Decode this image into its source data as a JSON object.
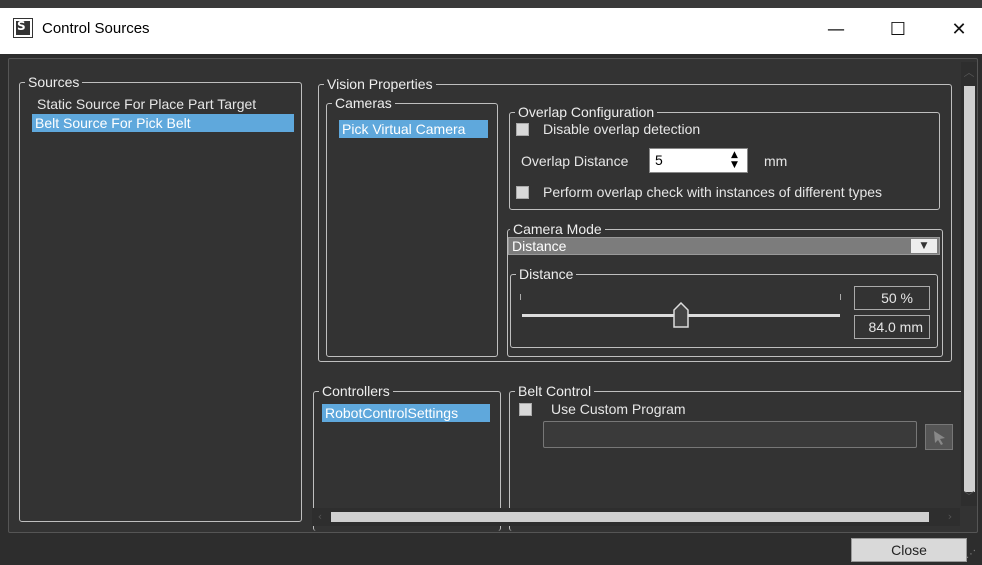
{
  "window": {
    "title": "Control Sources",
    "minimize_glyph": "—",
    "maximize_glyph": "☐",
    "close_glyph": "✕"
  },
  "sources": {
    "legend": "Sources",
    "items": [
      {
        "label": "Static Source For Place Part Target",
        "selected": false
      },
      {
        "label": "Belt Source For Pick Belt",
        "selected": true
      }
    ]
  },
  "vision": {
    "legend": "Vision Properties",
    "cameras": {
      "legend": "Cameras",
      "items": [
        "Pick Virtual Camera"
      ]
    },
    "overlap": {
      "legend": "Overlap Configuration",
      "disable_label": "Disable overlap detection",
      "distance_label": "Overlap Distance",
      "distance_value": "5",
      "distance_unit": "mm",
      "different_types_label": "Perform overlap check with instances of different types"
    },
    "camera_mode": {
      "legend": "Camera Mode",
      "selected": "Distance"
    },
    "distance": {
      "legend": "Distance",
      "percent": "50 %",
      "mm": "84.0 mm",
      "slider_fraction": 0.5
    }
  },
  "controllers": {
    "legend": "Controllers",
    "items": [
      "RobotControlSettings"
    ]
  },
  "belt_control": {
    "legend": "Belt Control",
    "custom_label": "Use Custom Program",
    "program_value": ""
  },
  "footer": {
    "close_label": "Close"
  },
  "colors": {
    "selection": "#5fa8dc",
    "background": "#2d2d2d",
    "panel": "#333333"
  }
}
